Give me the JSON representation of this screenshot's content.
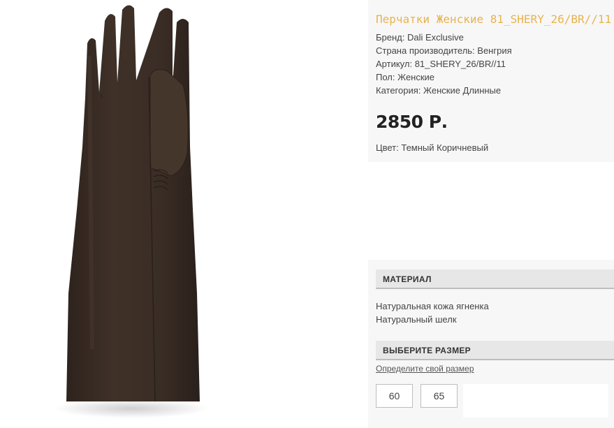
{
  "product": {
    "title": "Перчатки Женские 81_SHERY_26/BR//11",
    "image_alt": "long-leather-glove",
    "specs": [
      "Бренд: Dali Exclusive",
      "Страна производитель: Венгрия",
      "Артикул: 81_SHERY_26/BR//11",
      "Пол: Женские",
      "Категория: Женские Длинные"
    ],
    "price": "2850 Р.",
    "color": "Цвет: Темный Коричневый"
  },
  "material": {
    "header": "МАТЕРИАЛ",
    "items": [
      "Натуральная кожа ягненка",
      "Натуральный шелк"
    ]
  },
  "sizes": {
    "header": "ВЫБЕРИТЕ РАЗМЕР",
    "link": "Определите свой размер",
    "options": [
      "60",
      "65"
    ]
  },
  "colors": {
    "title": "#e8b44f",
    "glove": "#3a2c24"
  }
}
